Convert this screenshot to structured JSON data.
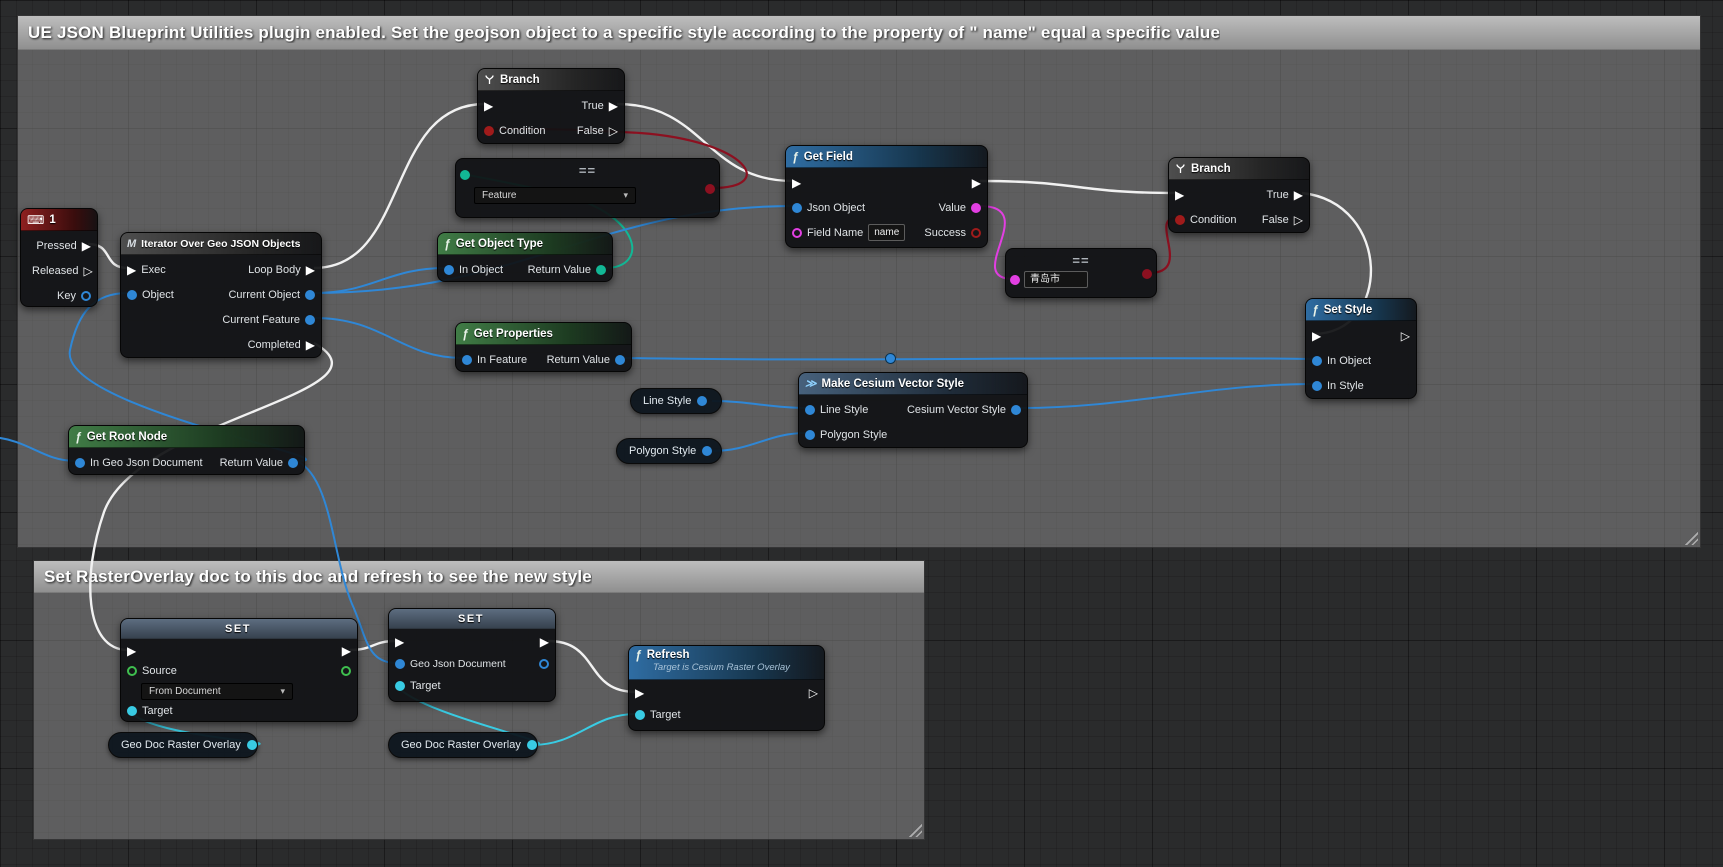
{
  "comments": {
    "main": {
      "title": "UE JSON Blueprint Utilities plugin enabled. Set the geojson object to a specific style according to  the property of \" name\"  equal a specific value"
    },
    "raster": {
      "title": "Set RasterOverlay doc to this doc  and refresh to see the new style"
    }
  },
  "ui": {
    "exec_filled": "▶",
    "exec_hollow": "▷",
    "equals_operator": "==",
    "function_icon": "ƒ",
    "macro_icon": "M",
    "keyboard_icon": "⌨",
    "make_icon": "≫",
    "chevron": "▾"
  },
  "colors": {
    "exec_wire": "#f1f1f1",
    "object_pin": "#2f87d6",
    "cyan_pin": "#39cbe3",
    "string_pin": "#e23fe2",
    "bool_pin": "#a01b1b",
    "enum_pin": "#12b795",
    "byte_pin": "#3fbf4f",
    "wire_red": "#8c1020"
  },
  "nodes": {
    "key_event": {
      "title": "1",
      "pins": {
        "pressed": "Pressed",
        "released": "Released",
        "key": "Key"
      }
    },
    "iterator": {
      "title": "Iterator Over Geo JSON Objects",
      "pins": {
        "exec": "Exec",
        "object": "Object",
        "loop_body": "Loop Body",
        "current_object": "Current Object",
        "current_feature": "Current Feature",
        "completed": "Completed"
      }
    },
    "branch_top": {
      "title": "Branch",
      "pins": {
        "condition": "Condition",
        "true_out": "True",
        "false_out": "False"
      }
    },
    "branch_right": {
      "title": "Branch",
      "pins": {
        "condition": "Condition",
        "true_out": "True",
        "false_out": "False"
      }
    },
    "equal_enum": {
      "selected_value": "Feature"
    },
    "equal_string": {
      "value": "青岛市"
    },
    "get_field": {
      "title": "Get Field",
      "pins": {
        "json_object": "Json Object",
        "field_name": "Field Name",
        "field_name_value": "name",
        "value": "Value",
        "success": "Success"
      }
    },
    "get_object_type": {
      "title": "Get Object Type",
      "pins": {
        "in_object": "In Object",
        "return_value": "Return Value"
      }
    },
    "get_properties": {
      "title": "Get Properties",
      "pins": {
        "in_feature": "In Feature",
        "return_value": "Return Value"
      }
    },
    "get_root_node": {
      "title": "Get Root Node",
      "pins": {
        "in_geo_json_document": "In Geo Json Document",
        "return_value": "Return Value"
      }
    },
    "set_style": {
      "title": "Set Style",
      "pins": {
        "in_object": "In Object",
        "in_style": "In Style"
      }
    },
    "make_vector_style": {
      "title": "Make Cesium Vector Style",
      "pins": {
        "line_style": "Line Style",
        "polygon_style": "Polygon Style",
        "return_value": "Cesium Vector Style"
      }
    },
    "line_style_var": {
      "label": "Line Style"
    },
    "polygon_style_var": {
      "label": "Polygon Style"
    },
    "set_source": {
      "title": "SET",
      "pins": {
        "source": "Source",
        "source_value": "From Document",
        "target": "Target"
      }
    },
    "set_geo_json_document": {
      "title": "SET",
      "pins": {
        "geo_json_document": "Geo Json Document",
        "target": "Target"
      }
    },
    "refresh": {
      "title": "Refresh",
      "subtitle": "Target is Cesium Raster Overlay",
      "pins": {
        "target": "Target"
      }
    },
    "overlay_var_left": {
      "label": "Geo Doc Raster Overlay"
    },
    "overlay_var_right": {
      "label": "Geo Doc Raster Overlay"
    }
  }
}
